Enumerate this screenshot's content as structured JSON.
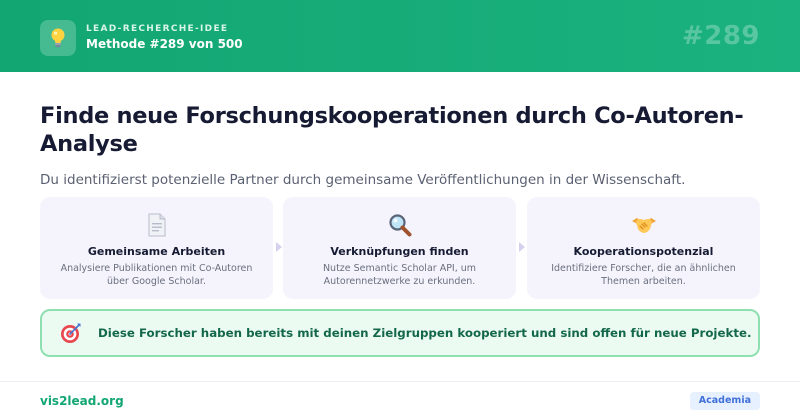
{
  "header": {
    "eyebrow": "LEAD-RECHERCHE-IDEE",
    "method": "Methode #289 von 500",
    "number": "#289",
    "icon": "lightbulb-icon"
  },
  "main": {
    "title": "Finde neue Forschungskooperationen durch Co-Autoren-Analyse",
    "subtitle": "Du identifizierst potenzielle Partner durch gemeinsame Veröffentlichungen in der Wissenschaft."
  },
  "steps": [
    {
      "icon": "document-icon",
      "title": "Gemeinsame Arbeiten",
      "desc": "Analysiere Publikationen mit Co-Autoren über Google Scholar."
    },
    {
      "icon": "magnifier-icon",
      "title": "Verknüpfungen finden",
      "desc": "Nutze Semantic Scholar API, um Autorennetzwerke zu erkunden."
    },
    {
      "icon": "handshake-icon",
      "title": "Kooperationspotenzial",
      "desc": "Identifiziere Forscher, die an ähnlichen Themen arbeiten."
    }
  ],
  "callout": {
    "icon": "target-icon",
    "text": "Diese Forscher haben bereits mit deinen Zielgruppen kooperiert und sind offen für neue Projekte."
  },
  "footer": {
    "link": "vis2lead.org",
    "tag": "Academia"
  },
  "colors": {
    "header_green": "#12a672",
    "card_bg": "#f5f4fd",
    "callout_bg": "#ecfbf2",
    "callout_border": "#8ee0b0",
    "callout_text": "#14684a",
    "tag_bg": "#e7f0fe",
    "tag_text": "#3f6fd8"
  }
}
